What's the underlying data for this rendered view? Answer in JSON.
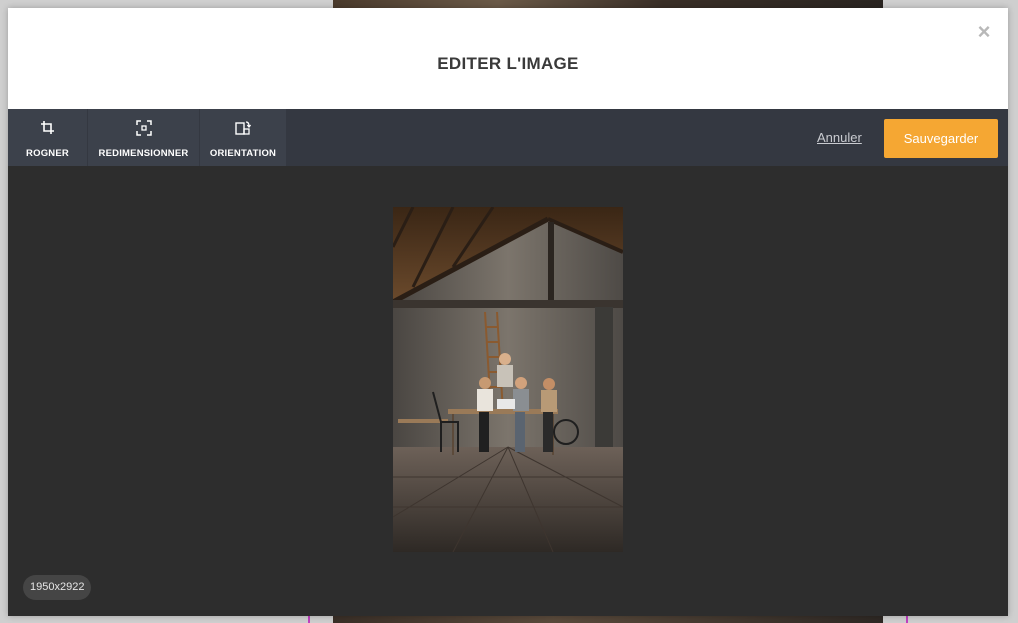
{
  "modal": {
    "title": "EDITER L'IMAGE",
    "close_glyph": "×"
  },
  "toolbar": {
    "tools": [
      {
        "label": "ROGNER",
        "icon": "crop-icon"
      },
      {
        "label": "REDIMENSIONNER",
        "icon": "resize-icon"
      },
      {
        "label": "ORIENTATION",
        "icon": "rotate-icon"
      }
    ],
    "cancel_label": "Annuler",
    "save_label": "Sauvegarder"
  },
  "image": {
    "dimensions": "1950x2922"
  },
  "colors": {
    "accent": "#f5a733",
    "toolbar_bg": "#343841",
    "tool_bg": "#3c414b",
    "canvas_bg": "#2d2d2d"
  }
}
